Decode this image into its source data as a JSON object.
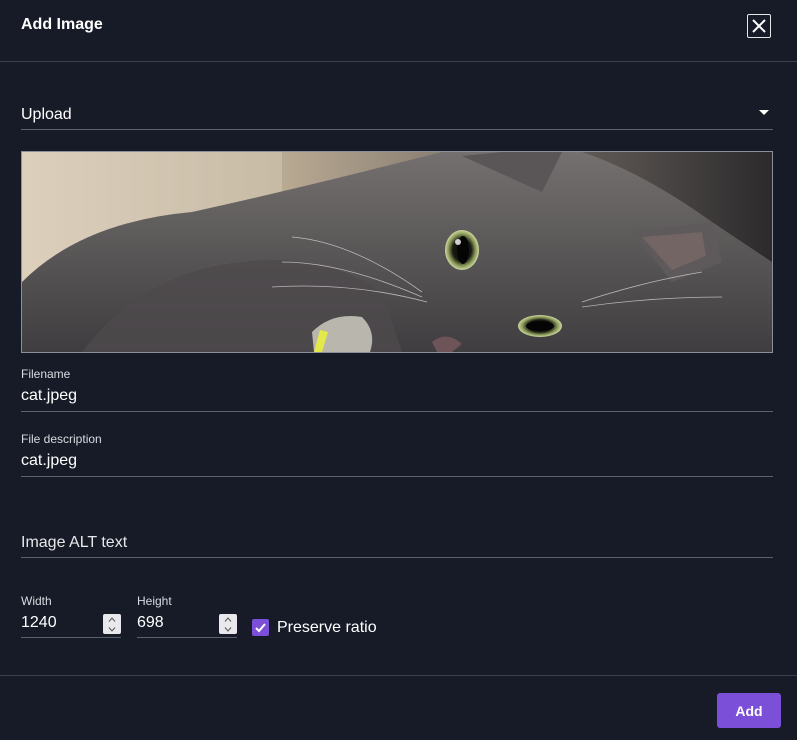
{
  "dialog": {
    "title": "Add Image",
    "close_icon": "close-icon"
  },
  "source_select": {
    "value": "Upload",
    "icon": "caret-down-icon"
  },
  "preview": {
    "image_subject": "photo of a grey cat lying down"
  },
  "filename": {
    "label": "Filename",
    "value": "cat.jpeg"
  },
  "description": {
    "label": "File description",
    "value": "cat.jpeg"
  },
  "alt_text": {
    "placeholder": "Image ALT text",
    "value": ""
  },
  "width": {
    "label": "Width",
    "value": "1240"
  },
  "height": {
    "label": "Height",
    "value": "698"
  },
  "preserve_ratio": {
    "label": "Preserve ratio",
    "checked": true
  },
  "footer": {
    "add_label": "Add"
  },
  "colors": {
    "background": "#161b27",
    "accent": "#7b4fd8",
    "divider": "#3a404c",
    "underline": "#5a606c"
  }
}
